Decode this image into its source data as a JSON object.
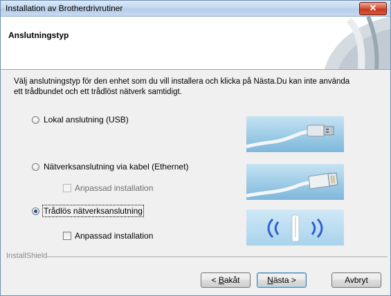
{
  "window": {
    "title": "Installation av Brotherdrivrutiner"
  },
  "header": {
    "title": "Anslutningstyp"
  },
  "description": "Välj anslutningstyp för den enhet som du vill installera och klicka på Nästa.Du kan inte använda ett trådbundet och ett trådlöst nätverk samtidigt.",
  "options": [
    {
      "label": "Lokal anslutning (USB)",
      "selected": false
    },
    {
      "label": "Nätverksanslutning via kabel (Ethernet)",
      "selected": false,
      "sub": {
        "label": "Anpassad installation",
        "enabled": false,
        "checked": false
      }
    },
    {
      "label": "Trådlös nätverksanslutning",
      "selected": true,
      "sub": {
        "label": "Anpassad installation",
        "enabled": true,
        "checked": false
      }
    }
  ],
  "footer": {
    "brand": "InstallShield",
    "back": {
      "pre": "< ",
      "key": "B",
      "rest": "akåt"
    },
    "next": {
      "key": "N",
      "rest": "ästa >"
    },
    "cancel": "Avbryt"
  },
  "colors": {
    "accent": "#1a4fa0",
    "close": "#c5381d",
    "wireless_icon": "#2f5fd0"
  }
}
